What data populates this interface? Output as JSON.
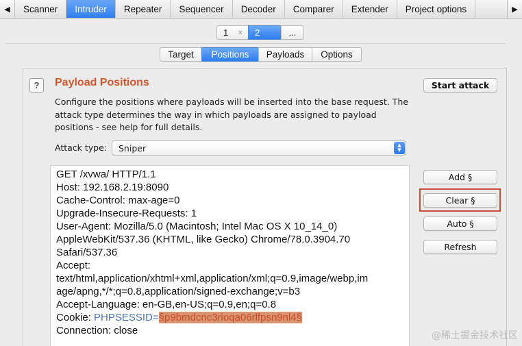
{
  "top_tabs": [
    "Scanner",
    "Intruder",
    "Repeater",
    "Sequencer",
    "Decoder",
    "Comparer",
    "Extender",
    "Project options"
  ],
  "active_top_tab": "Intruder",
  "scroll_left_glyph": "◀",
  "scroll_right_glyph": "▶",
  "attack_tabs": {
    "tab1": "1",
    "tab1_close": "×",
    "tab2": "2",
    "more": "..."
  },
  "sub_tabs": {
    "target": "Target",
    "positions": "Positions",
    "payloads": "Payloads",
    "options": "Options"
  },
  "active_sub_tab": "Positions",
  "positions": {
    "help_glyph": "?",
    "title": "Payload Positions",
    "description_lines": [
      "Configure the positions where payloads will be inserted into the base request. The",
      "attack type determines the way in which payloads are assigned to payload",
      "positions - see help for full details."
    ],
    "start_attack": "Start attack",
    "attack_type_label": "Attack type:",
    "attack_type_value": "Sniper"
  },
  "request": {
    "lines": [
      "GET /xvwa/ HTTP/1.1",
      "Host: 192.168.2.19:8090",
      "Cache-Control: max-age=0",
      "Upgrade-Insecure-Requests: 1",
      "User-Agent: Mozilla/5.0 (Macintosh; Intel Mac OS X 10_14_0)",
      "AppleWebKit/537.36 (KHTML, like Gecko) Chrome/78.0.3904.70",
      "Safari/537.36",
      "Accept:",
      "text/html,application/xhtml+xml,application/xml;q=0.9,image/webp,im",
      "age/apng,*/*;q=0.8,application/signed-exchange;v=b3",
      "Accept-Language: en-GB,en-US;q=0.9,en;q=0.8"
    ],
    "cookie_prefix": "Cookie: ",
    "cookie_name": "PHPSESSID",
    "cookie_eq": "=",
    "cookie_payload": "§p9bmdcnc3rioqa06rlfpsn9nl4§",
    "last_line": "Connection: close"
  },
  "side_buttons": {
    "add": "Add §",
    "clear": "Clear §",
    "auto": "Auto §",
    "refresh": "Refresh"
  },
  "highlighted_button": "Clear §",
  "watermark": "@稀土掘金技术社区",
  "colors": {
    "accent_blue": "#2f7ff0",
    "title_orange": "#d2572d",
    "highlight_red": "#c2533a",
    "payload_bg": "#d99470"
  }
}
